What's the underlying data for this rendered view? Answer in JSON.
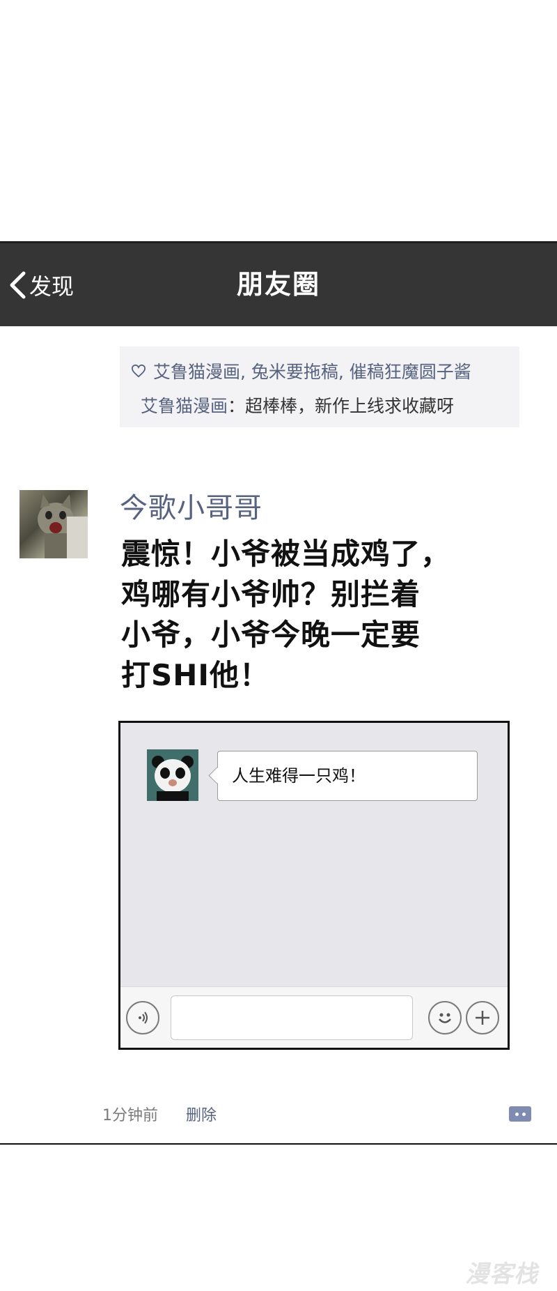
{
  "navbar": {
    "back_label": "发现",
    "title": "朋友圈"
  },
  "likes": {
    "names": "艾鲁猫漫画, 兔米要拖稿, 催稿狂魔圆子酱"
  },
  "comment": {
    "author": "艾鲁猫漫画",
    "separator": "：",
    "text": "超棒棒，新作上线求收藏呀"
  },
  "post": {
    "username": "今歌小哥哥",
    "text_lines": [
      "震惊！小爷被当成鸡了，",
      "鸡哪有小爷帅？别拦着",
      "小爷，小爷今晚一定要",
      "打SHI他！"
    ],
    "time": "1分钟前",
    "delete_label": "删除"
  },
  "chat_screenshot": {
    "message": "人生难得一只鸡！",
    "input_value": ""
  },
  "watermark": "漫客栈",
  "colors": {
    "navbar_bg": "#363536",
    "link_blue": "#56627f",
    "likes_bg": "#f3f3f5",
    "chat_bg": "#e7e6ea"
  }
}
